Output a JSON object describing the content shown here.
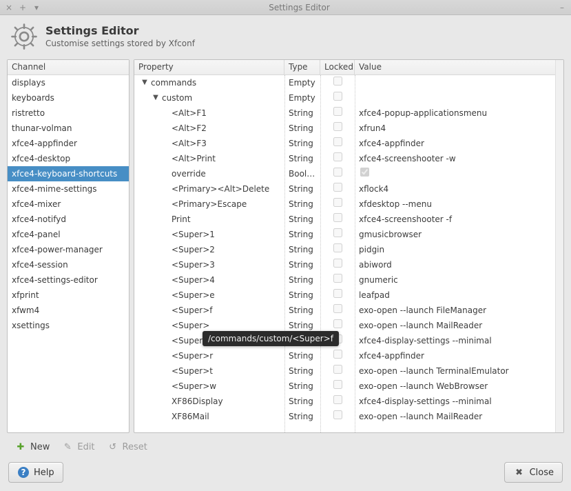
{
  "window": {
    "title": "Settings Editor",
    "controls": {
      "close": "×",
      "new": "+",
      "menu": "▾",
      "min": "–"
    }
  },
  "header": {
    "title": "Settings Editor",
    "subtitle": "Customise settings stored by Xfconf"
  },
  "channels": {
    "header": "Channel",
    "items": [
      "displays",
      "keyboards",
      "ristretto",
      "thunar-volman",
      "xfce4-appfinder",
      "xfce4-desktop",
      "xfce4-keyboard-shortcuts",
      "xfce4-mime-settings",
      "xfce4-mixer",
      "xfce4-notifyd",
      "xfce4-panel",
      "xfce4-power-manager",
      "xfce4-session",
      "xfce4-settings-editor",
      "xfprint",
      "xfwm4",
      "xsettings"
    ],
    "selected_index": 6
  },
  "properties": {
    "headers": {
      "property": "Property",
      "type": "Type",
      "locked": "Locked",
      "value": "Value"
    },
    "rows": [
      {
        "indent": 0,
        "disclose": "▼",
        "name": "commands",
        "type": "Empty",
        "locked": false,
        "value": ""
      },
      {
        "indent": 1,
        "disclose": "▼",
        "name": "custom",
        "type": "Empty",
        "locked": false,
        "value": ""
      },
      {
        "indent": 2,
        "name": "<Alt>F1",
        "type": "String",
        "locked": false,
        "value": "xfce4-popup-applicationsmenu"
      },
      {
        "indent": 2,
        "name": "<Alt>F2",
        "type": "String",
        "locked": false,
        "value": "xfrun4"
      },
      {
        "indent": 2,
        "name": "<Alt>F3",
        "type": "String",
        "locked": false,
        "value": "xfce4-appfinder"
      },
      {
        "indent": 2,
        "name": "<Alt>Print",
        "type": "String",
        "locked": false,
        "value": "xfce4-screenshooter -w"
      },
      {
        "indent": 2,
        "name": "override",
        "type": "Boolean",
        "locked": false,
        "value_bool": true
      },
      {
        "indent": 2,
        "name": "<Primary><Alt>Delete",
        "type": "String",
        "locked": false,
        "value": "xflock4"
      },
      {
        "indent": 2,
        "name": "<Primary>Escape",
        "type": "String",
        "locked": false,
        "value": "xfdesktop --menu"
      },
      {
        "indent": 2,
        "name": "Print",
        "type": "String",
        "locked": false,
        "value": "xfce4-screenshooter -f"
      },
      {
        "indent": 2,
        "name": "<Super>1",
        "type": "String",
        "locked": false,
        "value": "gmusicbrowser"
      },
      {
        "indent": 2,
        "name": "<Super>2",
        "type": "String",
        "locked": false,
        "value": "pidgin"
      },
      {
        "indent": 2,
        "name": "<Super>3",
        "type": "String",
        "locked": false,
        "value": "abiword"
      },
      {
        "indent": 2,
        "name": "<Super>4",
        "type": "String",
        "locked": false,
        "value": "gnumeric"
      },
      {
        "indent": 2,
        "name": "<Super>e",
        "type": "String",
        "locked": false,
        "value": "leafpad"
      },
      {
        "indent": 2,
        "name": "<Super>f",
        "type": "String",
        "locked": false,
        "value": "exo-open --launch FileManager"
      },
      {
        "indent": 2,
        "name": "<Super>",
        "type": "String",
        "locked": false,
        "value": "exo-open --launch MailReader"
      },
      {
        "indent": 2,
        "name": "<Super>p",
        "type": "String",
        "locked": false,
        "value": "xfce4-display-settings --minimal"
      },
      {
        "indent": 2,
        "name": "<Super>r",
        "type": "String",
        "locked": false,
        "value": "xfce4-appfinder"
      },
      {
        "indent": 2,
        "name": "<Super>t",
        "type": "String",
        "locked": false,
        "value": "exo-open --launch TerminalEmulator"
      },
      {
        "indent": 2,
        "name": "<Super>w",
        "type": "String",
        "locked": false,
        "value": "exo-open --launch WebBrowser"
      },
      {
        "indent": 2,
        "name": "XF86Display",
        "type": "String",
        "locked": false,
        "value": "xfce4-display-settings --minimal"
      },
      {
        "indent": 2,
        "name": "XF86Mail",
        "type": "String",
        "locked": false,
        "value": "exo-open --launch MailReader"
      }
    ]
  },
  "tooltip": {
    "text": "/commands/custom/<Super>f"
  },
  "toolbar": {
    "new": "New",
    "edit": "Edit",
    "reset": "Reset"
  },
  "footer": {
    "help": "Help",
    "close": "Close"
  }
}
